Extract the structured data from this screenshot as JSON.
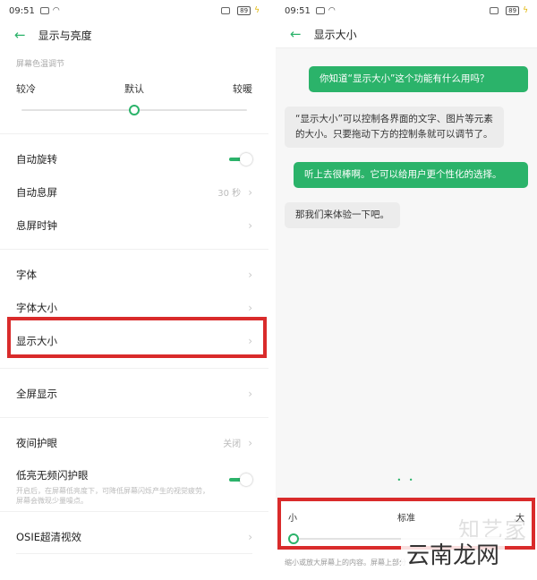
{
  "left": {
    "status": {
      "time": "09:51",
      "battery": "89"
    },
    "title": "显示与亮度",
    "color_temp": {
      "section_label": "屏幕色温调节",
      "cold": "较冷",
      "default": "默认",
      "warm": "较暖",
      "level": 0.5
    },
    "rows": {
      "auto_rotate": "自动旋转",
      "auto_lock": "自动息屏",
      "auto_lock_value": "30 秒",
      "lock_clock": "息屏时钟",
      "font": "字体",
      "font_size": "字体大小",
      "display_size": "显示大小",
      "full_screen": "全屏显示",
      "night_mode": "夜间护眼",
      "night_mode_value": "关闭",
      "dc_dimming": "低亮无频闪护眼",
      "dc_dimming_desc": "开启后，在屏幕低亮度下，可降低屏幕闪烁产生的视觉疲劳，屏幕会微现少量噪点。",
      "osie": "OSIE超清视效"
    }
  },
  "right": {
    "status": {
      "time": "09:51",
      "battery": "89"
    },
    "title": "显示大小",
    "messages": [
      {
        "from": "me",
        "text": "你知道“显示大小”这个功能有什么用吗？"
      },
      {
        "from": "bot",
        "text": "“显示大小”可以控制各界面的文字、图片等元素的大小。只要拖动下方的控制条就可以调节了。"
      },
      {
        "from": "me",
        "text": "听上去很棒啊。它可以给用户更个性化的选择。"
      },
      {
        "from": "bot",
        "text": "那我们来体验一下吧。"
      }
    ],
    "size": {
      "small": "小",
      "standard": "标准",
      "large": "大",
      "level": 0,
      "desc": "缩小或放大屏幕上的内容。屏幕上部分"
    }
  },
  "watermark": {
    "top": "知艺家",
    "bottom": "云南龙网"
  },
  "colors": {
    "accent": "#2bb36a",
    "highlight": "#d92b2b"
  }
}
